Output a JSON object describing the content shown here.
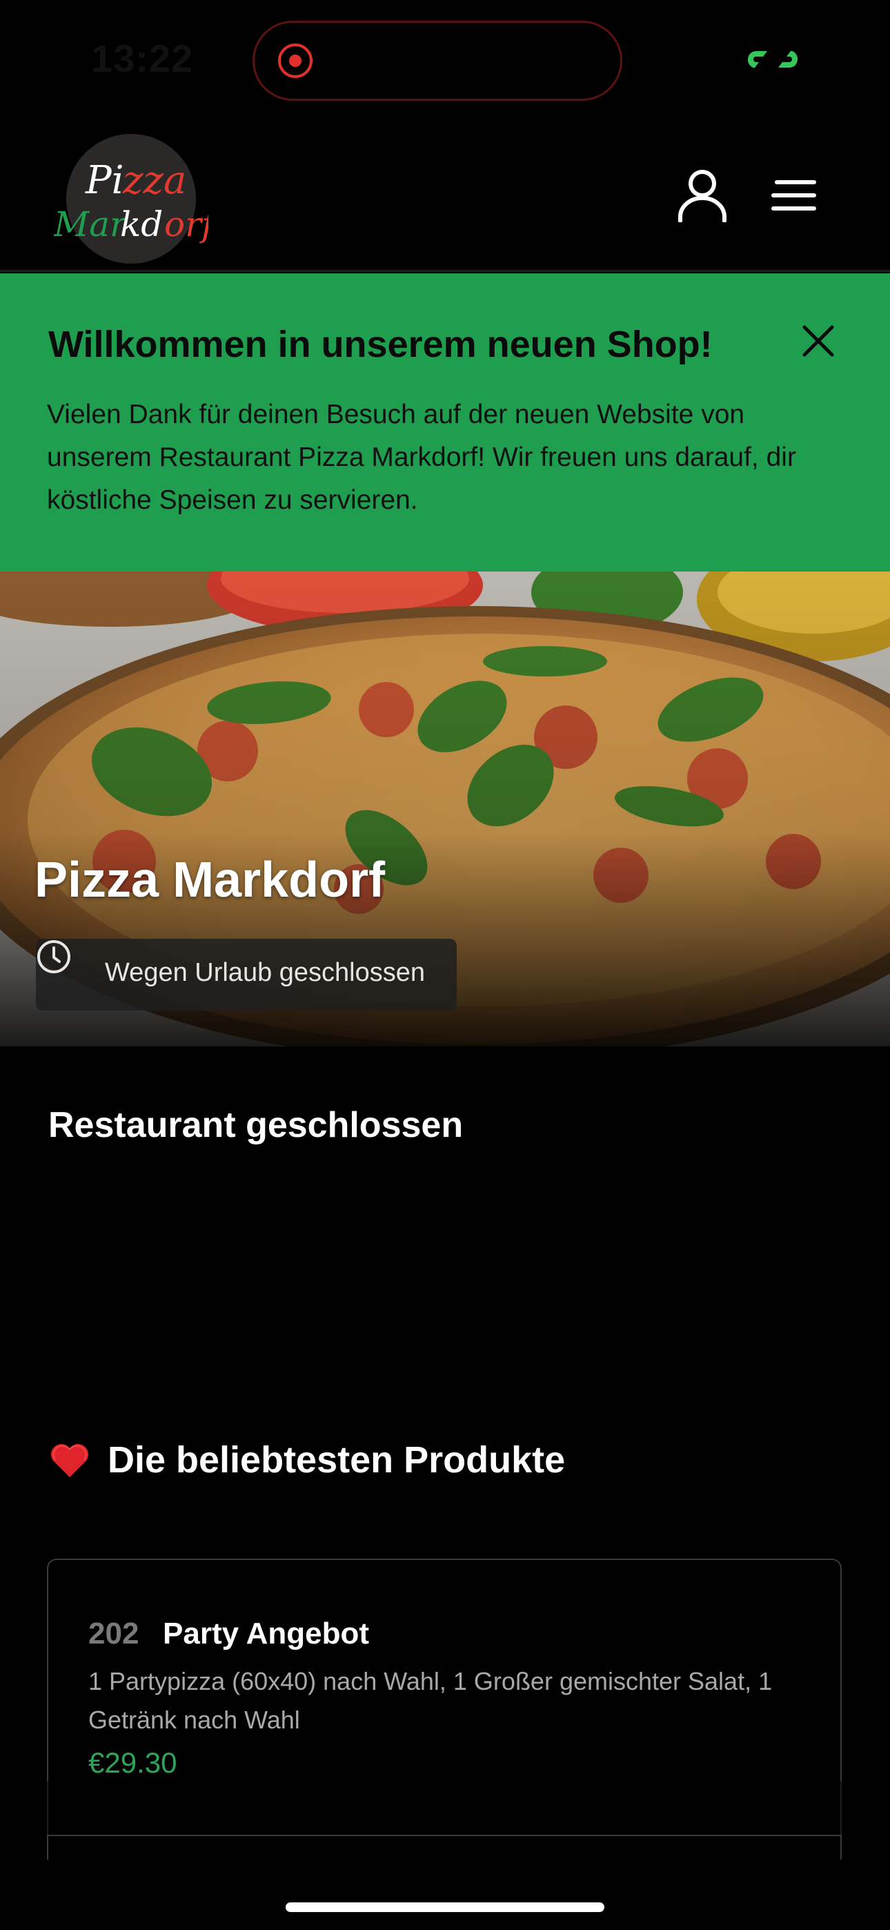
{
  "status_bar": {
    "time": "13:22",
    "recording_indicator": "record-icon",
    "link_indicator": "link-icon",
    "link_color": "#34c759",
    "record_color": "#e2312b"
  },
  "header": {
    "logo_line1": "Pizza",
    "logo_line2": "Markdorf",
    "user_icon": "user-icon",
    "menu_icon": "menu-icon"
  },
  "banner": {
    "title": "Willkommen in unserem neuen Shop!",
    "text": "Vielen Dank für deinen Besuch auf der neuen Website von unserem Restaurant Pizza Markdorf! Wir freuen uns darauf, dir köstliche Speisen zu servieren.",
    "close_icon": "close-icon",
    "background": "#1f9e50"
  },
  "hero": {
    "title": "Pizza Markdorf",
    "status": "Wegen Urlaub geschlossen",
    "status_icon": "clock-icon"
  },
  "restaurant_status": {
    "title": "Restaurant geschlossen"
  },
  "popular": {
    "heading": "Die beliebtesten Produkte",
    "heading_icon": "heart-icon",
    "products": [
      {
        "number": "202",
        "name": "Party Angebot",
        "description": "1 Partypizza (60x40) nach Wahl, 1 Großer gemischter Salat, 1 Getränk nach Wahl",
        "price": "€29.30"
      }
    ]
  },
  "accent_color": "#2aa55a"
}
